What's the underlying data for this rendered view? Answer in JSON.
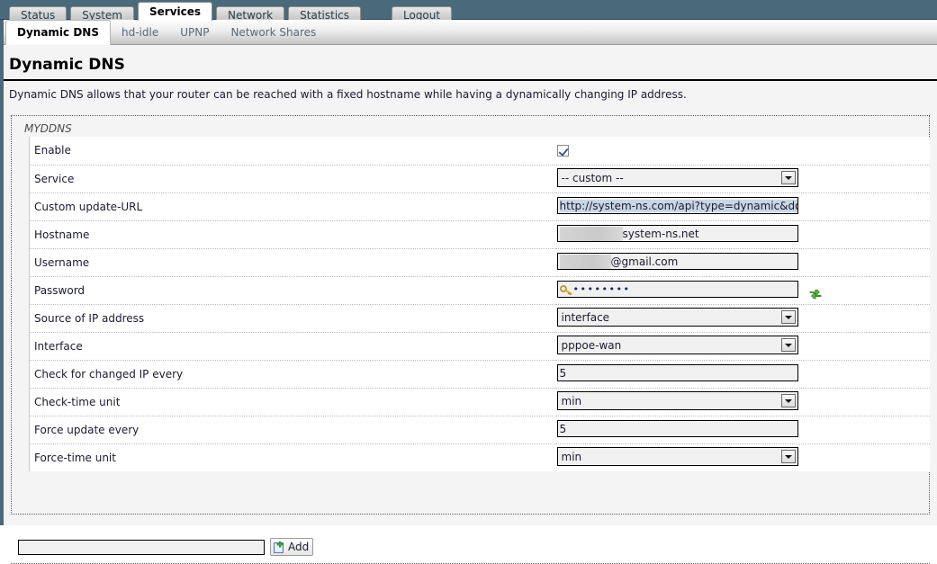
{
  "window": {
    "accent_dark": "#4a6a7b",
    "selection_color": "#c9d6e4"
  },
  "main_tabs": [
    {
      "label": "Status",
      "active": false
    },
    {
      "label": "System",
      "active": false
    },
    {
      "label": "Services",
      "active": true
    },
    {
      "label": "Network",
      "active": false
    },
    {
      "label": "Statistics",
      "active": false
    },
    {
      "label": "Logout",
      "active": false
    }
  ],
  "sub_tabs": [
    {
      "label": "Dynamic DNS",
      "active": true
    },
    {
      "label": "hd-idle",
      "active": false
    },
    {
      "label": "UPNP",
      "active": false
    },
    {
      "label": "Network Shares",
      "active": false
    }
  ],
  "page": {
    "title": "Dynamic DNS",
    "description": "Dynamic DNS allows that your router can be reached with a fixed hostname while having a dynamically changing IP address.",
    "legend": "MYDDNS"
  },
  "form": {
    "rows": [
      {
        "label": "Enable",
        "type": "checkbox",
        "checked": true
      },
      {
        "label": "Service",
        "type": "select",
        "value": "-- custom --"
      },
      {
        "label": "Custom update-URL",
        "type": "text-selected",
        "value": "http://system-ns.com/api?type=dynamic&dom"
      },
      {
        "label": "Hostname",
        "type": "text-redacted",
        "value": "system-ns.net",
        "redacted": true
      },
      {
        "label": "Username",
        "type": "text-redacted",
        "value": "@gmail.com",
        "redacted": true
      },
      {
        "label": "Password",
        "type": "password",
        "value": "••••••••"
      },
      {
        "label": "Source of IP address",
        "type": "select",
        "value": "interface"
      },
      {
        "label": "Interface",
        "type": "select",
        "value": "pppoe-wan"
      },
      {
        "label": "Check for changed IP every",
        "type": "text",
        "value": "5"
      },
      {
        "label": "Check-time unit",
        "type": "select",
        "value": "min"
      },
      {
        "label": "Force update every",
        "type": "text",
        "value": "5"
      },
      {
        "label": "Force-time unit",
        "type": "select",
        "value": "min"
      }
    ]
  },
  "add_section": {
    "input_value": "",
    "button_label": "Add"
  }
}
